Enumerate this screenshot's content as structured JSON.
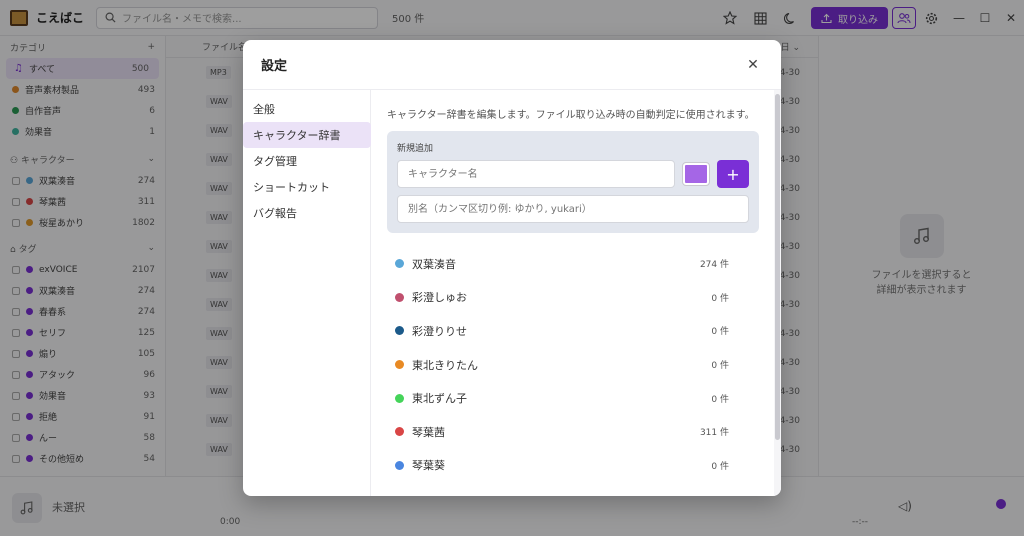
{
  "app": {
    "name": "こえばこ"
  },
  "search": {
    "placeholder": "ファイル名・メモで検索..."
  },
  "file_count": "500 件",
  "toolbar": {
    "import_label": "取り込み"
  },
  "sidebar": {
    "category_header": "カテゴリ",
    "add_symbol": "+",
    "categories": [
      {
        "label": "すべて",
        "count": "500",
        "color": "#7a2fd6"
      },
      {
        "label": "音声素材製品",
        "count": "493",
        "color": "#e08a2c"
      },
      {
        "label": "自作音声",
        "count": "6",
        "color": "#2a9a55"
      },
      {
        "label": "効果音",
        "count": "1",
        "color": "#3fb5a0"
      }
    ],
    "character_header": "キャラクター",
    "characters": [
      {
        "label": "双葉湊音",
        "count": "274",
        "color": "#5aa7d8"
      },
      {
        "label": "琴葉茜",
        "count": "311",
        "color": "#d94646"
      },
      {
        "label": "桜星あかり",
        "count": "1802",
        "color": "#e09a2c"
      }
    ],
    "tag_header": "タグ",
    "tags": [
      {
        "label": "exVOICE",
        "count": "2107",
        "color": "#7a2fd6"
      },
      {
        "label": "双葉湊音",
        "count": "274",
        "color": "#7a2fd6"
      },
      {
        "label": "春春系",
        "count": "274",
        "color": "#7a2fd6"
      },
      {
        "label": "セリフ",
        "count": "125",
        "color": "#7a2fd6"
      },
      {
        "label": "煽り",
        "count": "105",
        "color": "#7a2fd6"
      },
      {
        "label": "アタック",
        "count": "96",
        "color": "#7a2fd6"
      },
      {
        "label": "効果音",
        "count": "93",
        "color": "#7a2fd6"
      },
      {
        "label": "拒絶",
        "count": "91",
        "color": "#7a2fd6"
      },
      {
        "label": "んー",
        "count": "58",
        "color": "#7a2fd6"
      },
      {
        "label": "その他短め",
        "count": "54",
        "color": "#7a2fd6"
      }
    ]
  },
  "list": {
    "column_header": "ファイル名",
    "date_header": "日",
    "rows": [
      {
        "format": "MP3",
        "date": "4-30"
      },
      {
        "format": "WAV",
        "date": "4-30"
      },
      {
        "format": "WAV",
        "date": "4-30"
      },
      {
        "format": "WAV",
        "date": "4-30"
      },
      {
        "format": "WAV",
        "date": "4-30"
      },
      {
        "format": "WAV",
        "date": "4-30"
      },
      {
        "format": "WAV",
        "date": "4-30"
      },
      {
        "format": "WAV",
        "date": "4-30"
      },
      {
        "format": "WAV",
        "date": "4-30"
      },
      {
        "format": "WAV",
        "date": "4-30"
      },
      {
        "format": "WAV",
        "date": "4-30"
      },
      {
        "format": "WAV",
        "date": "4-30"
      },
      {
        "format": "WAV",
        "date": "4-30"
      },
      {
        "format": "WAV",
        "date": "4-30"
      }
    ]
  },
  "detail": {
    "line1": "ファイルを選択すると",
    "line2": "詳細が表示されます"
  },
  "player": {
    "track": "未選択",
    "time_start": "0:00",
    "time_end": "--:--"
  },
  "modal": {
    "title": "設定",
    "close": "✕",
    "nav": [
      {
        "label": "全般",
        "active": false
      },
      {
        "label": "キャラクター辞書",
        "active": true
      },
      {
        "label": "タグ管理",
        "active": false
      },
      {
        "label": "ショートカット",
        "active": false
      },
      {
        "label": "バグ報告",
        "active": false
      }
    ],
    "description": "キャラクター辞書を編集します。ファイル取り込み時の自動判定に使用されます。",
    "new_entry": {
      "label": "新規追加",
      "name_placeholder": "キャラクター名",
      "alias_placeholder": "別名（カンマ区切り例: ゆかり, yukari）",
      "swatch_color": "#a566e6",
      "add_symbol": "+"
    },
    "characters": [
      {
        "name": "双葉湊音",
        "count": "274 件",
        "color": "#5aa7d8"
      },
      {
        "name": "彩澄しゅお",
        "count": "0 件",
        "color": "#c0506e"
      },
      {
        "name": "彩澄りりせ",
        "count": "0 件",
        "color": "#1c5a8a"
      },
      {
        "name": "東北きりたん",
        "count": "0 件",
        "color": "#e88a24"
      },
      {
        "name": "東北ずん子",
        "count": "0 件",
        "color": "#45d45a"
      },
      {
        "name": "琴葉茜",
        "count": "311 件",
        "color": "#d94646"
      },
      {
        "name": "琴葉葵",
        "count": "0 件",
        "color": "#4a86e0"
      }
    ]
  }
}
